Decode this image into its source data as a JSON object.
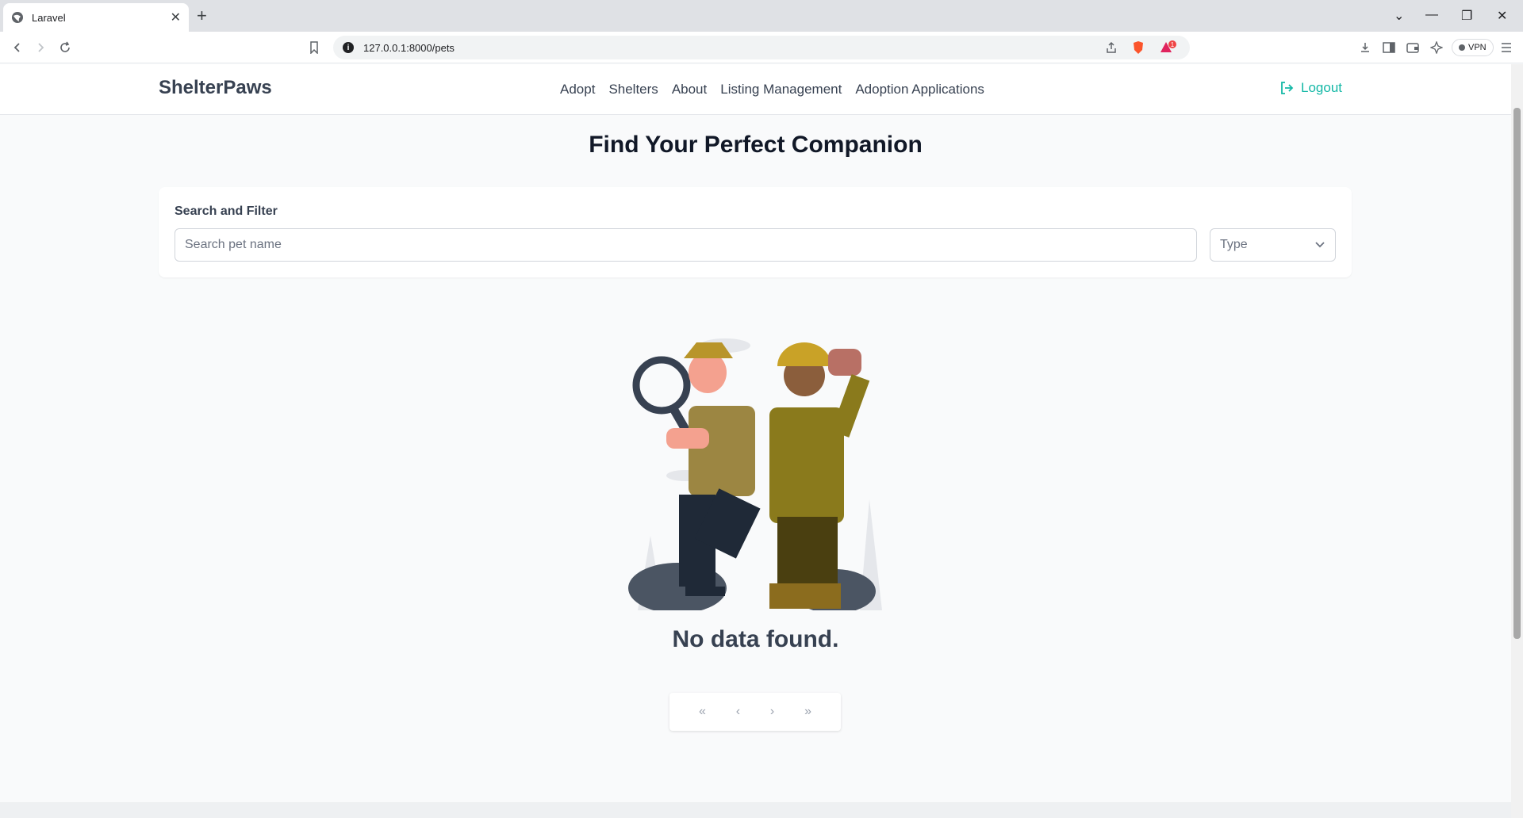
{
  "browser": {
    "tab_title": "Laravel",
    "new_tab": "+",
    "tab_close": "✕",
    "url": "127.0.0.1:8000/pets",
    "vpn_label": "VPN",
    "notification_count": "1"
  },
  "header": {
    "brand": "ShelterPaws",
    "nav": [
      "Adopt",
      "Shelters",
      "About",
      "Listing Management",
      "Adoption Applications"
    ],
    "logout": "Logout"
  },
  "main": {
    "title": "Find Your Perfect Companion",
    "filter_label": "Search and Filter",
    "search_placeholder": "Search pet name",
    "type_select": "Type",
    "empty_message": "No data found."
  },
  "colors": {
    "accent": "#14b8a6",
    "background": "#f9fafb"
  },
  "pagination": {
    "first": "«",
    "prev": "‹",
    "next": "›",
    "last": "»"
  }
}
